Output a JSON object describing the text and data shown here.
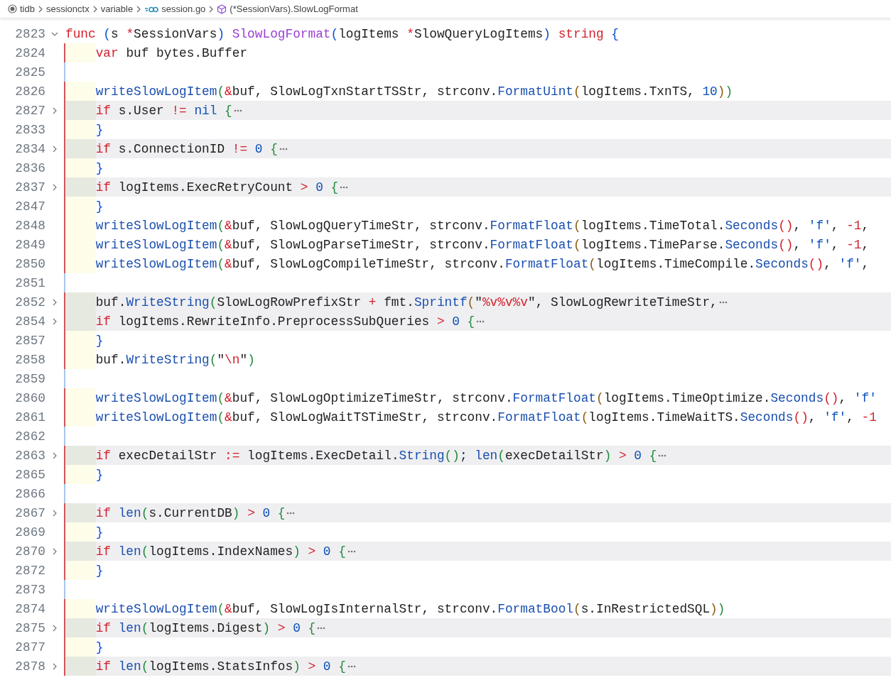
{
  "breadcrumb": [
    {
      "label": "tidb",
      "kind": "folder"
    },
    {
      "label": "sessionctx",
      "kind": "plain"
    },
    {
      "label": "variable",
      "kind": "plain"
    },
    {
      "label": "session.go",
      "kind": "gofile"
    },
    {
      "label": "(*SessionVars).SlowLogFormat",
      "kind": "method"
    }
  ],
  "lines": [
    {
      "number": "2823",
      "folded": false,
      "text": "func (s *SessionVars) SlowLogFormat(logItems *SlowQueryLogItems) string {",
      "children": [
        {
          "number": "2824",
          "color": "#d2555a",
          "text": "var buf bytes.Buffer"
        },
        {
          "number": "2825",
          "color": "#a9c6ec"
        },
        {
          "number": "2826",
          "color": "#d2555a",
          "text": "writeSlowLogItem(&buf, SlowLogTxnStartTSStr, strconv.FormatUint(logItems.TxnTS, 10))"
        },
        {
          "number": "2827",
          "color": "#d2555a",
          "folded": true,
          "text": "if s.User != nil {"
        },
        {
          "number": "2833",
          "color": "#d2555a",
          "text": "}"
        },
        {
          "number": "2834",
          "color": "#d2555a",
          "folded": true,
          "text": "if s.ConnectionID != 0 {"
        },
        {
          "number": "2836",
          "color": "#d2555a",
          "text": "}"
        },
        {
          "number": "2837",
          "color": "#d2555a",
          "folded": true,
          "text": "if logItems.ExecRetryCount > 0 {"
        },
        {
          "number": "2847",
          "color": "#d2555a",
          "text": "}"
        },
        {
          "number": "2848",
          "color": "#d2555a",
          "text": "writeSlowLogItem(&buf, SlowLogQueryTimeStr, strconv.FormatFloat(logItems.TimeTotal.Seconds(), 'f', -1,"
        },
        {
          "number": "2849",
          "color": "#d2555a",
          "text": "writeSlowLogItem(&buf, SlowLogParseTimeStr, strconv.FormatFloat(logItems.TimeParse.Seconds(), 'f', -1,"
        },
        {
          "number": "2850",
          "color": "#d2555a",
          "text": "writeSlowLogItem(&buf, SlowLogCompileTimeStr, strconv.FormatFloat(logItems.TimeCompile.Seconds(), 'f',"
        },
        {
          "number": "2851",
          "color": "#a9c6ec"
        },
        {
          "number": "2852",
          "color": "#d2555a",
          "folded": true,
          "text": "buf.WriteString(SlowLogRowPrefixStr + fmt.Sprintf(\"%v%v%v\", SlowLogRewriteTimeStr,"
        },
        {
          "number": "2854",
          "color": "#d2555a",
          "folded": true,
          "text": "if logItems.RewriteInfo.PreprocessSubQueries > 0 {"
        },
        {
          "number": "2857",
          "color": "#d2555a",
          "text": "}"
        },
        {
          "number": "2858",
          "color": "#d2555a",
          "text": "buf.WriteString(\"\\n\")"
        },
        {
          "number": "2859",
          "color": "#a9c6ec"
        },
        {
          "number": "2860",
          "color": "#d2555a",
          "text": "writeSlowLogItem(&buf, SlowLogOptimizeTimeStr, strconv.FormatFloat(logItems.TimeOptimize.Seconds(), 'f'"
        },
        {
          "number": "2861",
          "color": "#d2555a",
          "text": "writeSlowLogItem(&buf, SlowLogWaitTSTimeStr, strconv.FormatFloat(logItems.TimeWaitTS.Seconds(), 'f', -1"
        },
        {
          "number": "2862",
          "color": "#a9c6ec"
        },
        {
          "number": "2863",
          "color": "#d2555a",
          "folded": true,
          "text": "if execDetailStr := logItems.ExecDetail.String(); len(execDetailStr) > 0 {"
        },
        {
          "number": "2865",
          "color": "#d2555a",
          "text": "}"
        },
        {
          "number": "2866",
          "color": "#a9c6ec"
        },
        {
          "number": "2867",
          "color": "#d2555a",
          "folded": true,
          "text": "if len(s.CurrentDB) > 0 {"
        },
        {
          "number": "2869",
          "color": "#d2555a",
          "text": "}"
        },
        {
          "number": "2870",
          "color": "#d2555a",
          "folded": true,
          "text": "if len(logItems.IndexNames) > 0 {"
        },
        {
          "number": "2872",
          "color": "#d2555a",
          "text": "}"
        },
        {
          "number": "2873",
          "color": "#a9c6ec"
        },
        {
          "number": "2874",
          "color": "#d2555a",
          "text": "writeSlowLogItem(&buf, SlowLogIsInternalStr, strconv.FormatBool(s.InRestrictedSQL))"
        },
        {
          "number": "2875",
          "color": "#d2555a",
          "folded": true,
          "text": "if len(logItems.Digest) > 0 {"
        },
        {
          "number": "2877",
          "color": "#d2555a",
          "text": "}"
        },
        {
          "number": "2878",
          "color": "#d2555a",
          "folded": true,
          "text": "if len(logItems.StatsInfos) > 0 {"
        }
      ]
    }
  ]
}
